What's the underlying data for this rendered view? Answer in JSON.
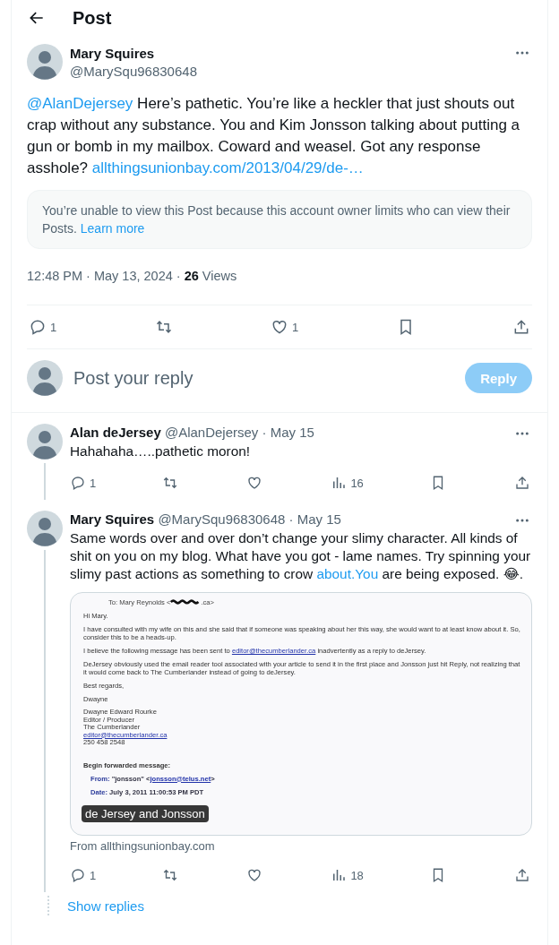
{
  "header": {
    "title": "Post"
  },
  "post": {
    "name": "Mary Squires",
    "handle": "@MarySqu96830648",
    "mention": "@AlanDejersey",
    "text": " Here’s pathetic. You’re like a heckler that just shouts out crap without any substance. You and Kim Jonsson talking about putting a gun or bomb in my mailbox. Coward and weasel. Got any response asshole? ",
    "link": "allthingsunionbay.com/2013/04/29/de-…",
    "notice": {
      "text": "You’re unable to view this Post because this account owner limits who can view their Posts. ",
      "link": "Learn more"
    },
    "time": "12:48 PM · May 13, 2024 · ",
    "views_count": "26",
    "views_label": " Views",
    "actions": [
      {
        "kind": "reply",
        "count": "1"
      },
      {
        "kind": "repost"
      },
      {
        "kind": "like",
        "count": "1"
      },
      {
        "kind": "bookmark"
      },
      {
        "kind": "share"
      }
    ]
  },
  "reply_box": {
    "placeholder": "Post your reply",
    "button": "Reply",
    "disabled": true
  },
  "replies": [
    {
      "name": "Alan deJersey",
      "handle": "@AlanDejersey",
      "date": " · May 15",
      "text": "Hahahaha…..pathetic moron!",
      "actions": [
        {
          "kind": "reply",
          "count": "1"
        },
        {
          "kind": "repost"
        },
        {
          "kind": "like"
        },
        {
          "kind": "views",
          "count": "16"
        },
        {
          "kind": "bookmark"
        },
        {
          "kind": "share"
        }
      ]
    },
    {
      "name": "Mary Squires",
      "handle": "@MarySqu96830648",
      "date": " · May 15",
      "text": "Same words over and over don’t change your slimy character. All kinds of shit on you on my blog. What have you got - lame names. Try spinning your slimy past actions as something to crow ",
      "link": "about.You",
      "after": " are being exposed. 😂.",
      "media": {
        "caption": "de Jersey and Jonsson",
        "source": "From allthingsunionbay.com",
        "doc": [
          {
            "kind": "field",
            "forwarded": false,
            "label": "To:",
            "value": "Mary Reynolds <",
            "redacted": true,
            "tail": ".ca>"
          },
          {
            "kind": "para",
            "before": "Hi Mary."
          },
          {
            "kind": "para",
            "before": "I have consulted with my wife on this and she said that if someone was speaking about her this way, she would want to at least know about it. So, consider this to be a heads-up."
          },
          {
            "kind": "para",
            "before": "I believe the following message has been sent to ",
            "link": "editor@thecumberlander.ca",
            "after": " inadvertently as a reply to deJersey."
          },
          {
            "kind": "para",
            "before": "DeJersey obviously used the email reader tool associated with your article to send it in the first place and Jonsson just hit Reply, not realizing that it would come back to The Cumberlander instead of going to deJersey."
          },
          {
            "kind": "para",
            "before": "Best regards,"
          },
          {
            "kind": "para",
            "before": "Dwayne"
          },
          {
            "kind": "lines",
            "lines": [
              {
                "text": "Dwayne Edward Rourke"
              },
              {
                "text": "Editor / Producer"
              },
              {
                "text": "The Cumberlander"
              },
              {
                "text": "editor@thecumberlander.ca",
                "link": true
              },
              {
                "text": "250 458 2548"
              }
            ]
          },
          {
            "kind": "heading",
            "before": "Begin forwarded message:"
          },
          {
            "kind": "field",
            "forwarded": true,
            "label": "From:",
            "value": "\"jonsson\" <",
            "link": "jonsson@telus.net",
            "tail": ">"
          },
          {
            "kind": "field",
            "forwarded": true,
            "label": "Date:",
            "value": "July 3, 2011 11:00:53 PM PDT"
          }
        ]
      },
      "actions": [
        {
          "kind": "reply",
          "count": "1"
        },
        {
          "kind": "repost"
        },
        {
          "kind": "like"
        },
        {
          "kind": "views",
          "count": "18"
        },
        {
          "kind": "bookmark"
        },
        {
          "kind": "share"
        }
      ]
    }
  ],
  "show_replies": "Show replies"
}
